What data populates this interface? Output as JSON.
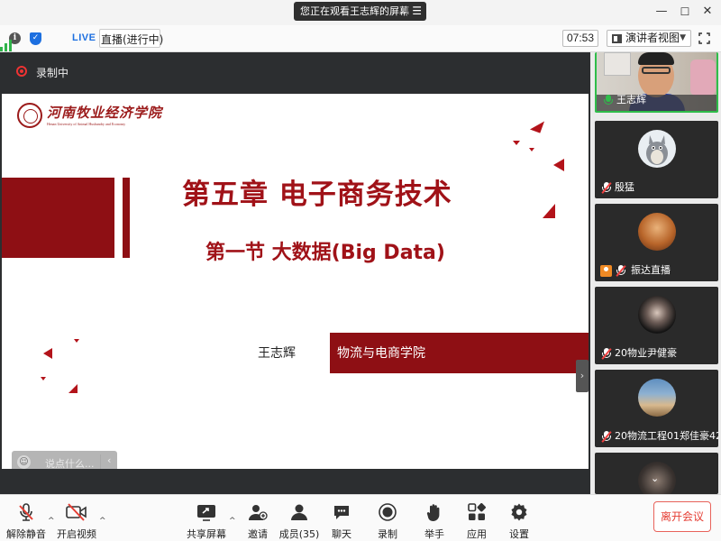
{
  "window": {
    "share_notice": "您正在观看王志辉的屏幕",
    "menu_icon": "menu-icon",
    "minimize": "—",
    "maximize": "☐",
    "close": "✕"
  },
  "toolbar": {
    "live_badge": "LIVE",
    "live_status": "直播(进行中)",
    "clock": "07:53",
    "view_mode": "演讲者视图"
  },
  "stage": {
    "recording_label": "录制中",
    "chat_placeholder": "说点什么..."
  },
  "slide": {
    "school_logo_cn": "河南牧业经济学院",
    "school_logo_en": "Henan University of Animal Husbandry and Economy",
    "chapter_title": "第五章  电子商务技术",
    "section_title": "第一节  大数据(Big Data)",
    "author": "王志辉",
    "department": "物流与电商学院"
  },
  "participants": [
    {
      "name": "王志辉",
      "mic": "on",
      "role": "speaker"
    },
    {
      "name": "殷猛",
      "mic": "muted"
    },
    {
      "name": "振达直播",
      "mic": "muted",
      "host": true
    },
    {
      "name": "20物业尹健豪",
      "mic": "muted"
    },
    {
      "name": "20物流工程01郑佳豪42",
      "mic": "muted"
    }
  ],
  "controls": {
    "unmute": "解除静音",
    "start_video": "开启视频",
    "share_screen": "共享屏幕",
    "invite": "邀请",
    "members": "成员(35)",
    "chat": "聊天",
    "record": "录制",
    "raise_hand": "举手",
    "apps": "应用",
    "settings": "设置",
    "leave": "离开会议"
  },
  "colors": {
    "brand_red": "#8e0f14",
    "title_red": "#a01218",
    "live_blue": "#1c6fe0",
    "active_green": "#2fbd4a",
    "leave_red": "#e53d33"
  }
}
